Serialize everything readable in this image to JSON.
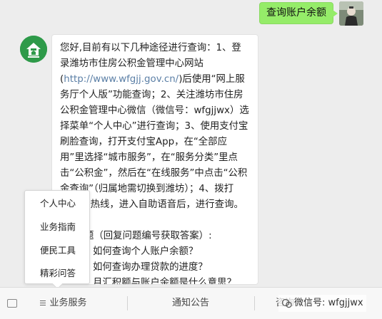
{
  "chat": {
    "outgoing_message": "查询账户余额",
    "reply_paragraphs": [
      "您好,目前有以下几种途径进行查询：1、登录潍坊市住房公积金管理中心网站(",
      "http://www.wfgjj.gov.cn/",
      ")后使用“网上服务厅个人版”功能查询；2、关注潍坊市住房公积金管理中心微信（微信号：wfgjjwx）选择菜单“个人中心”进行查询；3、使用支付宝刷脸查询，打开支付宝App，在“全部应用”里选择“城市服务”，在“服务分类”里点击“公积金”，然后在“在线服务”中点击“公积金查询”（归属地需切换到潍坊）；4、拨打12329热线，进入自助语音后，进行查询。"
    ],
    "faq_title": "题（回复问题编号获取答案）:",
    "faq_items": [
      "如何查询个人账户余额？",
      "如何查询办理贷款的进度？",
      "月汇积额与账户余额是什么意思？"
    ]
  },
  "popup_menu": {
    "items": [
      "个人中心",
      "业务指南",
      "便民工具",
      "精彩问答"
    ]
  },
  "menubar": {
    "items": [
      "业务服务",
      "通知公告",
      "咨询"
    ]
  },
  "watermark": {
    "text": "微信号: wfgjjwx"
  },
  "colors": {
    "outgoing_bubble": "#95ec69",
    "bot_avatar": "#2e9a49",
    "link": "#5b7fa6",
    "background": "#ededed"
  }
}
